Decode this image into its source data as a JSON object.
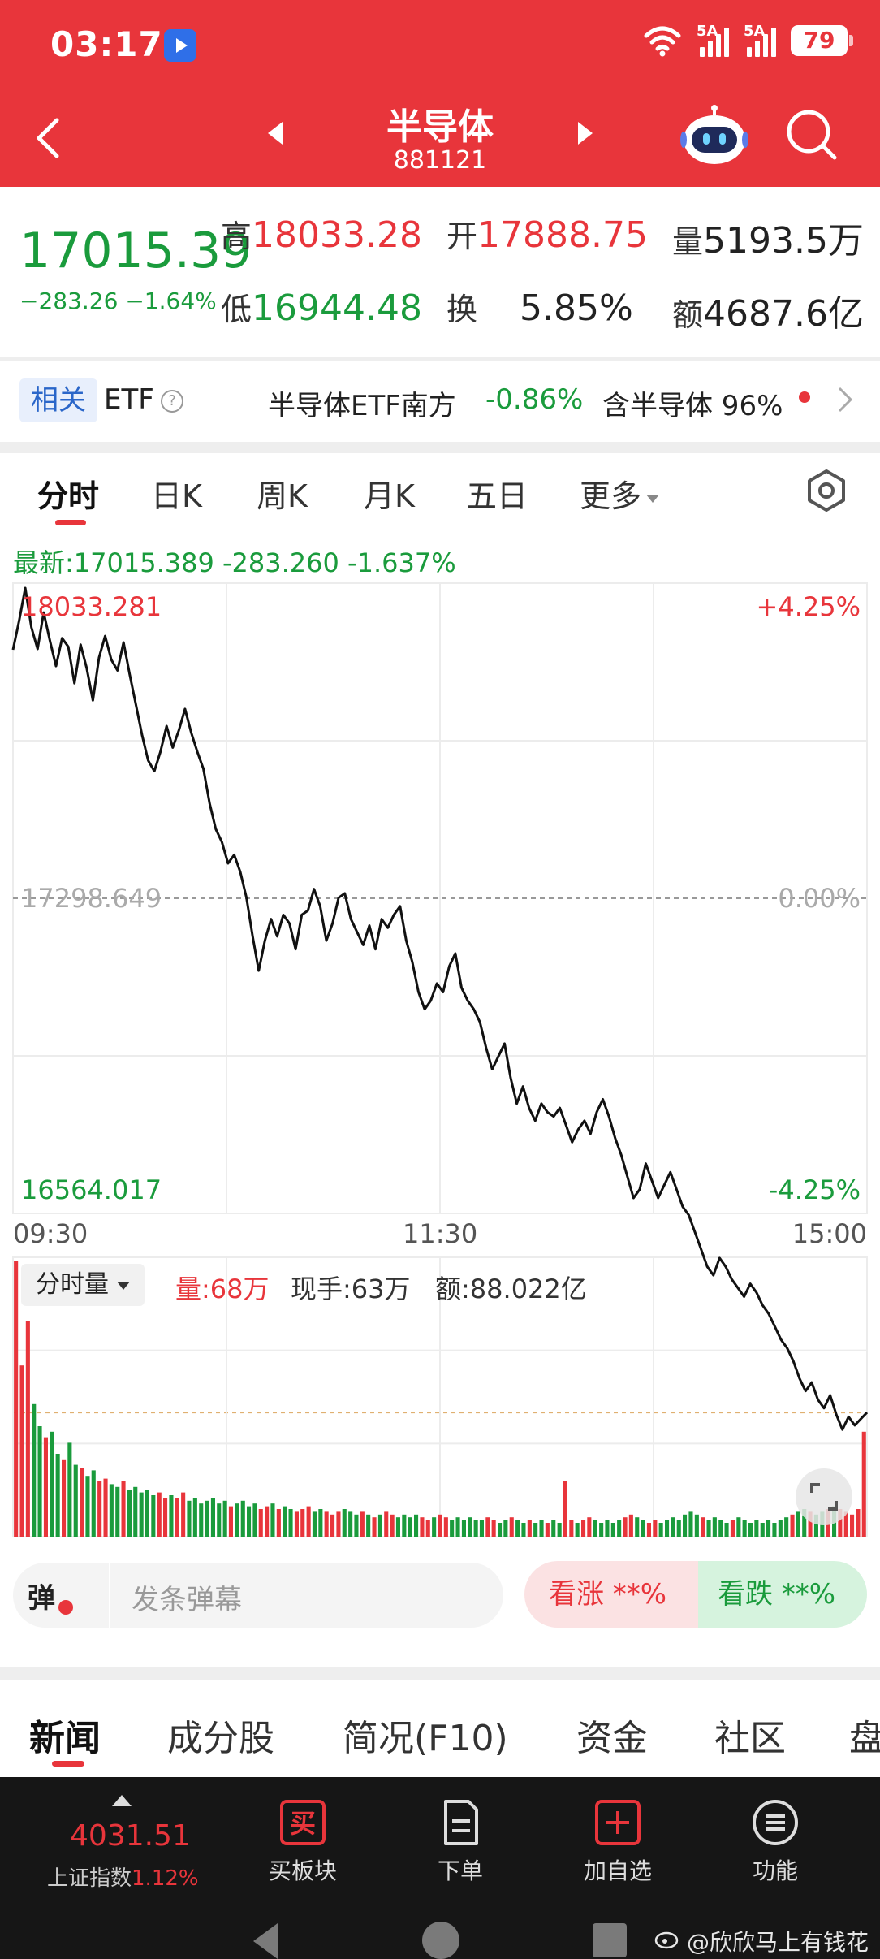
{
  "status_bar": {
    "time": "03:17",
    "signal_1_tag": "5A",
    "signal_2_tag": "5A",
    "battery": "79"
  },
  "nav": {
    "title": "半导体",
    "code": "881121",
    "icons": [
      "back-icon",
      "prev-icon",
      "next-icon",
      "robot-icon",
      "search-icon"
    ]
  },
  "quote": {
    "price": "17015.39",
    "change": "−283.26  −1.64%",
    "high_label": "高",
    "high": "18033.28",
    "open_label": "开",
    "open": "17888.75",
    "volume_label": "量",
    "volume": "5193.5万",
    "low_label": "低",
    "low": "16944.48",
    "turnover_label": "换",
    "turnover": "5.85%",
    "amount_label": "额",
    "amount": "4687.6亿"
  },
  "etf": {
    "tag": "相关",
    "label": "ETF",
    "help": "?",
    "name": "半导体ETF南方",
    "change": "-0.86%",
    "include": "含半导体 96%"
  },
  "chart_tabs": {
    "items": [
      "分时",
      "日K",
      "周K",
      "月K",
      "五日",
      "更多"
    ],
    "active": 0
  },
  "latest_line": "最新:17015.389 -283.260 -1.637%",
  "chart_data": [
    {
      "type": "line",
      "x_labels": [
        "09:30",
        "11:30",
        "15:00"
      ],
      "y_top_label": "18033.281",
      "y_mid_label": "17298.649",
      "y_bottom_label": "16564.017",
      "pct_top_label": "+4.25%",
      "pct_mid_label": "0.00%",
      "pct_bottom_label": "-4.25%",
      "ylim": [
        16564.017,
        18033.281
      ],
      "reference": 17298.649,
      "grid": true,
      "values": [
        17878,
        17946,
        18022,
        17930,
        17880,
        17965,
        17900,
        17840,
        17905,
        17885,
        17800,
        17890,
        17835,
        17760,
        17860,
        17910,
        17855,
        17830,
        17895,
        17820,
        17750,
        17680,
        17620,
        17595,
        17640,
        17700,
        17650,
        17690,
        17740,
        17685,
        17640,
        17600,
        17520,
        17460,
        17430,
        17380,
        17400,
        17360,
        17300,
        17210,
        17130,
        17200,
        17250,
        17210,
        17260,
        17240,
        17180,
        17260,
        17270,
        17320,
        17280,
        17200,
        17240,
        17300,
        17310,
        17250,
        17220,
        17190,
        17235,
        17180,
        17250,
        17230,
        17260,
        17280,
        17200,
        17150,
        17080,
        17040,
        17060,
        17100,
        17080,
        17140,
        17170,
        17090,
        17060,
        17040,
        17010,
        16950,
        16900,
        16930,
        16960,
        16880,
        16820,
        16860,
        16810,
        16780,
        16820,
        16800,
        16790,
        16810,
        16770,
        16730,
        16760,
        16780,
        16750,
        16800,
        16830,
        16790,
        16740,
        16700,
        16650,
        16600,
        16620,
        16680,
        16640,
        16600,
        16630,
        16660,
        16620,
        16580,
        16560,
        16520,
        16480,
        16440,
        16420,
        16460,
        16440,
        16410,
        16390,
        16370,
        16400,
        16380,
        16350,
        16330,
        16300,
        16270,
        16250,
        16220,
        16180,
        16150,
        16170,
        16130,
        16110,
        16140,
        16095,
        16060,
        16090,
        16070,
        16085,
        16100
      ]
    },
    {
      "type": "bar",
      "title": "分时量",
      "volume": "68万",
      "current_hand": "63万",
      "amount": "88.022亿",
      "values": [
        100,
        62,
        78,
        48,
        40,
        36,
        38,
        30,
        28,
        34,
        26,
        25,
        22,
        24,
        20,
        21,
        19,
        18,
        20,
        17,
        18,
        16,
        17,
        15,
        16,
        14,
        15,
        14,
        16,
        13,
        14,
        12,
        13,
        14,
        12,
        13,
        11,
        12,
        13,
        11,
        12,
        10,
        11,
        12,
        10,
        11,
        10,
        9,
        10,
        11,
        9,
        10,
        9,
        8,
        9,
        10,
        9,
        8,
        9,
        8,
        7,
        8,
        9,
        8,
        7,
        8,
        7,
        8,
        7,
        6,
        7,
        8,
        7,
        6,
        7,
        6,
        7,
        6,
        6,
        7,
        6,
        5,
        6,
        7,
        6,
        5,
        6,
        5,
        6,
        5,
        6,
        5,
        20,
        6,
        5,
        6,
        7,
        6,
        5,
        6,
        5,
        6,
        7,
        8,
        7,
        6,
        5,
        6,
        5,
        6,
        7,
        6,
        8,
        9,
        8,
        7,
        6,
        7,
        6,
        5,
        6,
        7,
        6,
        5,
        6,
        5,
        6,
        5,
        6,
        7,
        8,
        9,
        10,
        9,
        8,
        9,
        10,
        11,
        10,
        9,
        8,
        10,
        38
      ]
    }
  ],
  "danmu": {
    "badge": "弹",
    "placeholder": "发条弹幕",
    "up_label": "看涨 **%",
    "down_label": "看跌 **%"
  },
  "info_tabs": {
    "items": [
      "新闻",
      "成分股",
      "简况(F10)",
      "资金",
      "社区",
      "盘"
    ],
    "active": 0
  },
  "bottom_bar": {
    "index_value": "4031.51",
    "index_name": "上证指数",
    "index_change": "1.12%",
    "items": [
      {
        "label": "买板块",
        "icon": "buy-icon",
        "glyph": "买"
      },
      {
        "label": "下单",
        "icon": "document-icon"
      },
      {
        "label": "加自选",
        "icon": "plus-icon"
      },
      {
        "label": "功能",
        "icon": "menu-icon"
      }
    ]
  },
  "watermark": "@欣欣马上有钱花",
  "colors": {
    "brand_red": "#e8353b",
    "down_green": "#1a9b3c",
    "up_red": "#e8353b"
  }
}
